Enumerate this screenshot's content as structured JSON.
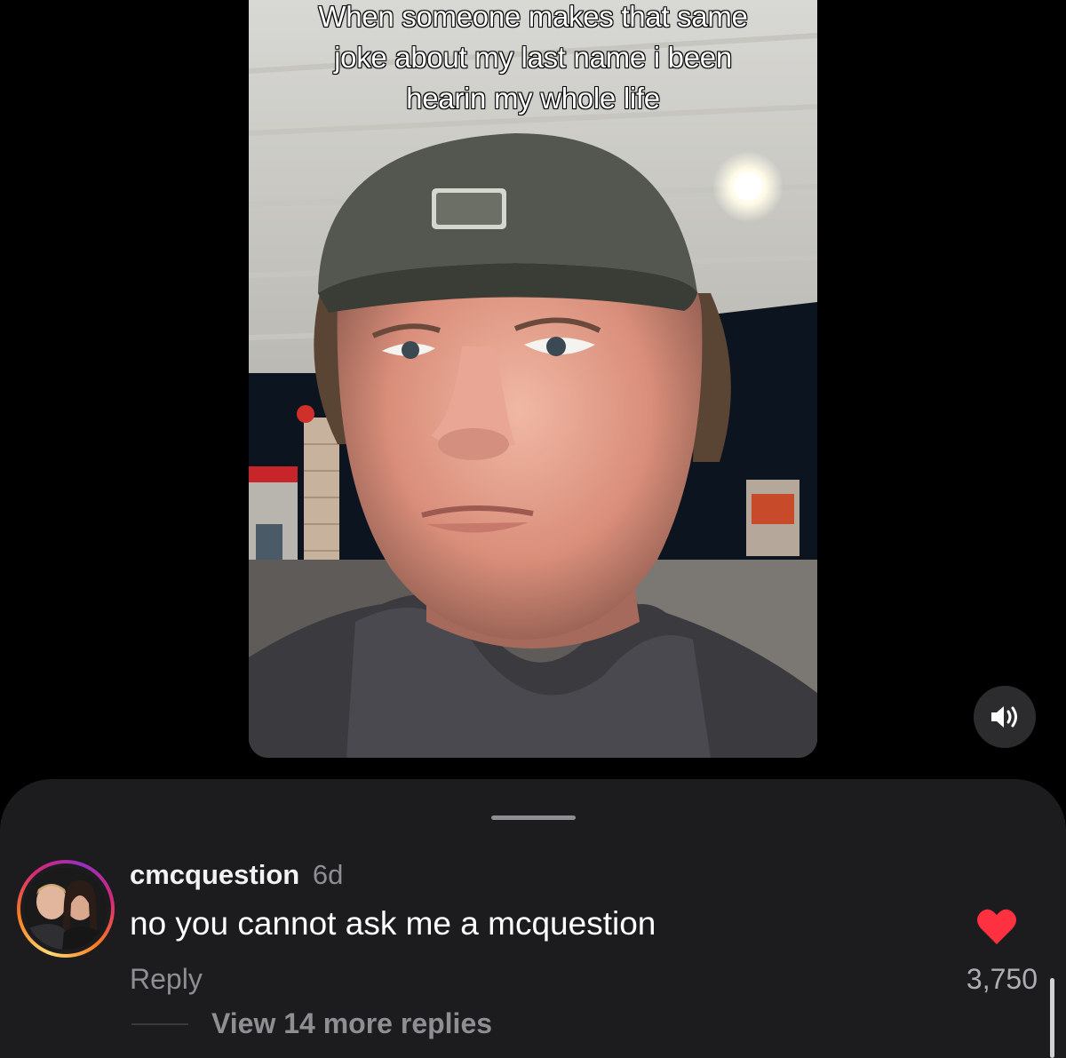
{
  "video": {
    "caption": "When someone makes that same joke about my last name i been hearin my whole life"
  },
  "controls": {
    "volume_icon": "speaker-wave-icon"
  },
  "comment": {
    "username": "cmcquestion",
    "time": "6d",
    "text": "no you cannot ask me a mcquestion",
    "reply_label": "Reply",
    "like_count": "3,750",
    "liked": true,
    "heart_color": "#ff3040",
    "view_replies_label": "View 14 more replies"
  },
  "colors": {
    "background": "#000000",
    "sheet": "#1c1c1e",
    "muted_text": "#8e8e93"
  }
}
